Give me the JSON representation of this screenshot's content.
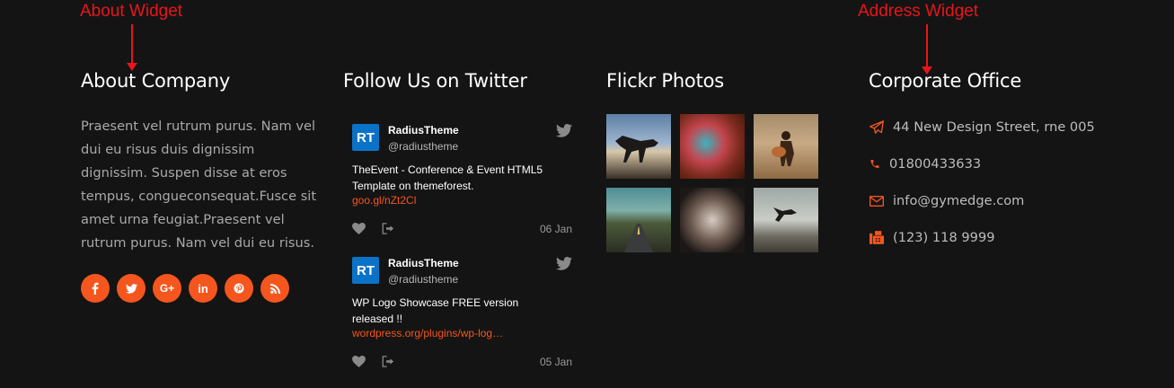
{
  "annotations": {
    "about_widget": "About Widget",
    "address_widget": "Address Widget"
  },
  "about": {
    "title": "About Company",
    "text": "Praesent vel rutrum purus. Nam vel dui eu risus duis dignissim dignissim. Suspen disse at eros tempus, congueconsequat.Fusce sit amet urna feugiat.Praesent vel rutrum purus. Nam vel dui eu risus.",
    "socials": [
      {
        "icon": "facebook-icon",
        "glyph": "f"
      },
      {
        "icon": "twitter-icon",
        "glyph": "t"
      },
      {
        "icon": "google-plus-icon",
        "glyph": "G+"
      },
      {
        "icon": "linkedin-icon",
        "glyph": "in"
      },
      {
        "icon": "pinterest-icon",
        "glyph": "p"
      },
      {
        "icon": "rss-icon",
        "glyph": "rss"
      }
    ]
  },
  "twitter": {
    "title": "Follow Us on Twitter",
    "tweets": [
      {
        "avatar": "RT",
        "name": "RadiusTheme",
        "handle": "@radiustheme",
        "text": "TheEvent - Conference & Event HTML5 Template on themeforest.",
        "link": "goo.gl/nZt2Cl",
        "date": "06 Jan"
      },
      {
        "avatar": "RT",
        "name": "RadiusTheme",
        "handle": "@radiustheme",
        "text": "WP Logo Showcase FREE version released !!",
        "link": "wordpress.org/plugins/wp-log…",
        "date": "05 Jan"
      }
    ]
  },
  "flickr": {
    "title": "Flickr Photos"
  },
  "office": {
    "title": "Corporate Office",
    "address": "44 New Design Street, rne 005",
    "phone": "01800433633",
    "email": "info@gymedge.com",
    "fax": "(123) 118 9999"
  },
  "colors": {
    "accent": "#f5561e",
    "background": "#141414",
    "annotation": "#e8151b",
    "avatar": "#0b73c7"
  }
}
